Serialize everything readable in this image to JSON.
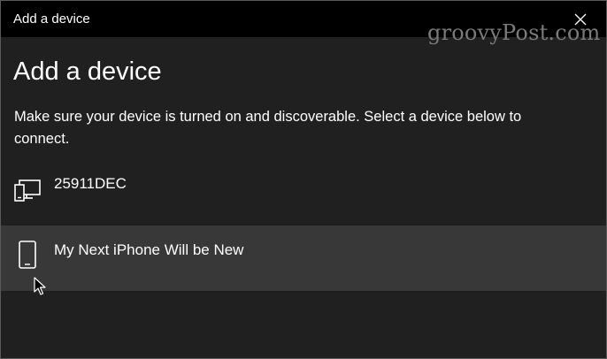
{
  "window": {
    "title": "Add a device",
    "close_icon": "close-icon"
  },
  "watermark": "groovyPost.com",
  "main": {
    "heading": "Add a device",
    "instructions": "Make sure your device is turned on and discoverable. Select a device below to connect."
  },
  "devices": [
    {
      "name": "25911DEC",
      "icon": "desktop-device-icon",
      "selected": false
    },
    {
      "name": "My Next iPhone Will be New",
      "icon": "phone-icon",
      "selected": true
    }
  ],
  "colors": {
    "titlebar_bg": "#000000",
    "window_bg": "#202020",
    "selected_row_bg": "#383838",
    "text": "#ffffff"
  }
}
